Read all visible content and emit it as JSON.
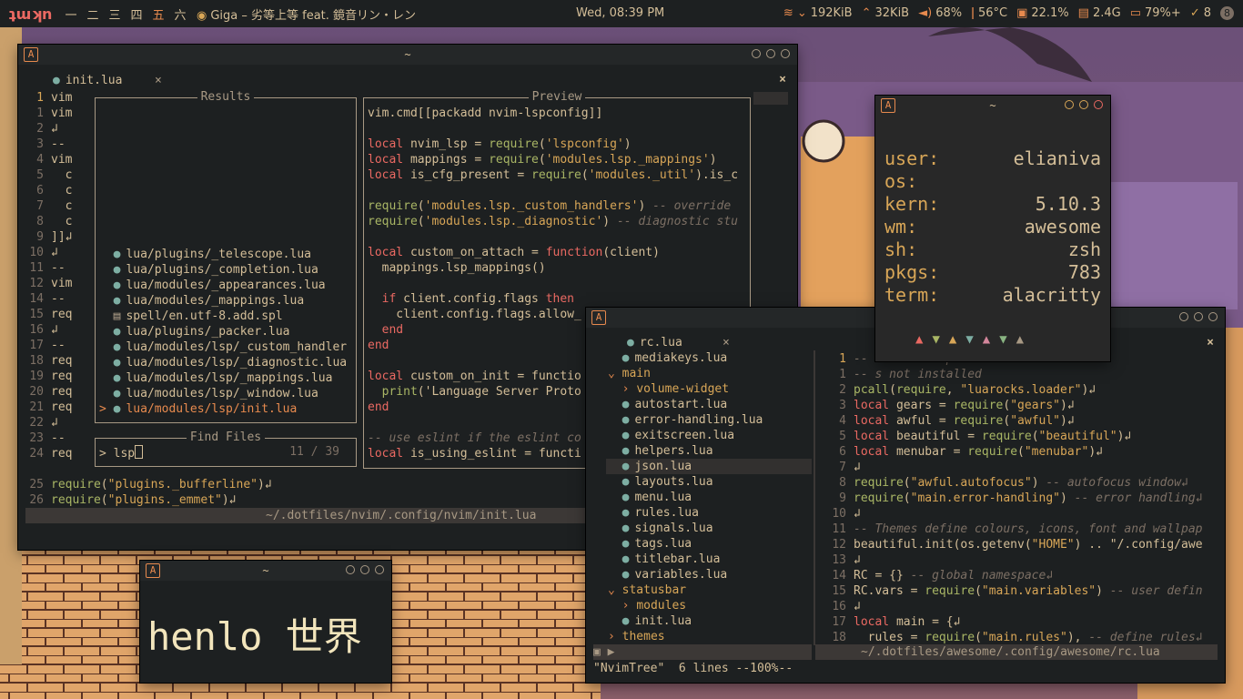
{
  "topbar": {
    "logo": "ʇɯʞn",
    "tags": [
      "一",
      "二",
      "三",
      "四",
      "五",
      "六"
    ],
    "active_tag": 4,
    "song": "Giga – 劣等上等 feat. 鏡音リン・レン",
    "clock": "Wed, 08:39 PM",
    "net_down": "192KiB",
    "net_up": "32KiB",
    "volume": "68%",
    "temp": "56°C",
    "cpu": "22.1%",
    "mem": "2.4G",
    "battery": "79%+",
    "updates": "8",
    "notif": "8"
  },
  "nvim_window": {
    "title": "~",
    "tab": "init.lua",
    "tab_close": "×",
    "close": "×",
    "gutter": [
      {
        "n": "1",
        "t": "vim"
      },
      {
        "n": "1",
        "t": "vim"
      },
      {
        "n": "2",
        "t": "↲"
      },
      {
        "n": "3",
        "t": "--"
      },
      {
        "n": "4",
        "t": "vim"
      },
      {
        "n": "5",
        "t": "  c"
      },
      {
        "n": "6",
        "t": "  c"
      },
      {
        "n": "7",
        "t": "  c"
      },
      {
        "n": "8",
        "t": "  c"
      },
      {
        "n": "9",
        "t": "]]↲"
      },
      {
        "n": "10",
        "t": "↲"
      },
      {
        "n": "11",
        "t": "--"
      },
      {
        "n": "12",
        "t": "vim"
      },
      {
        "n": "14",
        "t": "--"
      },
      {
        "n": "15",
        "t": "req"
      },
      {
        "n": "16",
        "t": "↲"
      },
      {
        "n": "17",
        "t": "--"
      },
      {
        "n": "18",
        "t": "req"
      },
      {
        "n": "19",
        "t": "req"
      },
      {
        "n": "20",
        "t": "req"
      },
      {
        "n": "21",
        "t": "req"
      },
      {
        "n": "22",
        "t": "↲"
      },
      {
        "n": "23",
        "t": "--"
      },
      {
        "n": "24",
        "t": "req"
      }
    ],
    "tail_lines": [
      {
        "n": "25",
        "t": "require(\"plugins._bufferline\")↲"
      },
      {
        "n": "26",
        "t": "require(\"plugins._emmet\")↲"
      }
    ],
    "statusline": "~/.dotfiles/nvim/.config/nvim/init.lua",
    "results_title": "Results",
    "preview_title": "Preview",
    "find_title": "Find Files",
    "prompt": "> lsp",
    "count": "11 / 39",
    "results": [
      "lua/plugins/_telescope.lua",
      "lua/plugins/_completion.lua",
      "lua/modules/_appearances.lua",
      "lua/modules/_mappings.lua",
      "spell/en.utf-8.add.spl",
      "lua/plugins/_packer.lua",
      "lua/modules/lsp/_custom_handler",
      "lua/modules/lsp/_diagnostic.lua",
      "lua/modules/lsp/_mappings.lua",
      "lua/modules/lsp/_window.lua",
      "lua/modules/lsp/init.lua"
    ],
    "selected_marker": ">",
    "preview": [
      "vim.cmd[[packadd nvim-lspconfig]]",
      "",
      "local nvim_lsp = require('lspconfig')",
      "local mappings = require('modules.lsp._mappings')",
      "local is_cfg_present = require('modules._util').is_c",
      "",
      "require('modules.lsp._custom_handlers') -- override",
      "require('modules.lsp._diagnostic') -- diagnostic stu",
      "",
      "local custom_on_attach = function(client)",
      "  mappings.lsp_mappings()",
      "",
      "  if client.config.flags then",
      "    client.config.flags.allow_",
      "  end",
      "end",
      "",
      "local custom_on_init = functio",
      "  print('Language Server Proto",
      "end",
      "",
      "-- use eslint if the eslint co",
      "local is_using_eslint = functi"
    ]
  },
  "fetch_window": {
    "title": "~",
    "rows": [
      {
        "k": "user:",
        "v": "elianiva"
      },
      {
        "k": "os:",
        "v": ""
      },
      {
        "k": "kern:",
        "v": "5.10.3"
      },
      {
        "k": "wm:",
        "v": "awesome"
      },
      {
        "k": "sh:",
        "v": "zsh"
      },
      {
        "k": "pkgs:",
        "v": "783"
      },
      {
        "k": "term:",
        "v": "alacritty"
      }
    ],
    "triangles": [
      {
        "c": "#ea6962",
        "g": "▲"
      },
      {
        "c": "#a9b665",
        "g": "▼"
      },
      {
        "c": "#d8a657",
        "g": "▲"
      },
      {
        "c": "#7daea3",
        "g": "▼"
      },
      {
        "c": "#d3869b",
        "g": "▲"
      },
      {
        "c": "#89b482",
        "g": "▼"
      },
      {
        "c": "#a89984",
        "g": "▲"
      }
    ]
  },
  "tree_window": {
    "title": "",
    "tab": "rc.lua",
    "tab_close": "×",
    "close": "×",
    "tree": [
      {
        "t": "mediakeys.lua",
        "type": "file",
        "indent": 1
      },
      {
        "t": "main",
        "type": "open",
        "indent": 0
      },
      {
        "t": "volume-widget",
        "type": "closed",
        "indent": 1
      },
      {
        "t": "autostart.lua",
        "type": "file",
        "indent": 1
      },
      {
        "t": "error-handling.lua",
        "type": "file",
        "indent": 1
      },
      {
        "t": "exitscreen.lua",
        "type": "file",
        "indent": 1
      },
      {
        "t": "helpers.lua",
        "type": "file",
        "indent": 1
      },
      {
        "t": "json.lua",
        "type": "file",
        "indent": 1,
        "sel": true
      },
      {
        "t": "layouts.lua",
        "type": "file",
        "indent": 1
      },
      {
        "t": "menu.lua",
        "type": "file",
        "indent": 1
      },
      {
        "t": "rules.lua",
        "type": "file",
        "indent": 1
      },
      {
        "t": "signals.lua",
        "type": "file",
        "indent": 1
      },
      {
        "t": "tags.lua",
        "type": "file",
        "indent": 1
      },
      {
        "t": "titlebar.lua",
        "type": "file",
        "indent": 1
      },
      {
        "t": "variables.lua",
        "type": "file",
        "indent": 1
      },
      {
        "t": "statusbar",
        "type": "open",
        "indent": 0
      },
      {
        "t": "modules",
        "type": "closed",
        "indent": 1
      },
      {
        "t": "init.lua",
        "type": "file",
        "indent": 1
      },
      {
        "t": "themes",
        "type": "closed",
        "indent": 0
      }
    ],
    "code": [
      {
        "n": "1",
        "t": "-- sure that packa"
      },
      {
        "n": "1",
        "t": "-- s not installed"
      },
      {
        "n": "2",
        "t": "pcall(require, \"luarocks.loader\")↲"
      },
      {
        "n": "3",
        "t": "local gears = require(\"gears\")↲"
      },
      {
        "n": "4",
        "t": "local awful = require(\"awful\")↲"
      },
      {
        "n": "5",
        "t": "local beautiful = require(\"beautiful\")↲"
      },
      {
        "n": "6",
        "t": "local menubar = require(\"menubar\")↲"
      },
      {
        "n": "7",
        "t": "↲"
      },
      {
        "n": "8",
        "t": "require(\"awful.autofocus\") -- autofocus window↲"
      },
      {
        "n": "9",
        "t": "require(\"main.error-handling\") -- error handling↲"
      },
      {
        "n": "10",
        "t": "↲"
      },
      {
        "n": "11",
        "t": "-- Themes define colours, icons, font and wallpap"
      },
      {
        "n": "12",
        "t": "beautiful.init(os.getenv(\"HOME\") .. \"/.config/awe"
      },
      {
        "n": "13",
        "t": "↲"
      },
      {
        "n": "14",
        "t": "RC = {} -- global namespace↲"
      },
      {
        "n": "15",
        "t": "RC.vars = require(\"main.variables\") -- user defin"
      },
      {
        "n": "16",
        "t": "↲"
      },
      {
        "n": "17",
        "t": "local main = {↲"
      },
      {
        "n": "18",
        "t": "  rules = require(\"main.rules\"), -- define rules↲"
      }
    ],
    "statusline": "~/.dotfiles/awesome/.config/awesome/rc.lua",
    "cmdline": "\"NvimTree\"  6 lines --100%--"
  },
  "henlo_window": {
    "title": "~",
    "text": "henlo 世界"
  }
}
